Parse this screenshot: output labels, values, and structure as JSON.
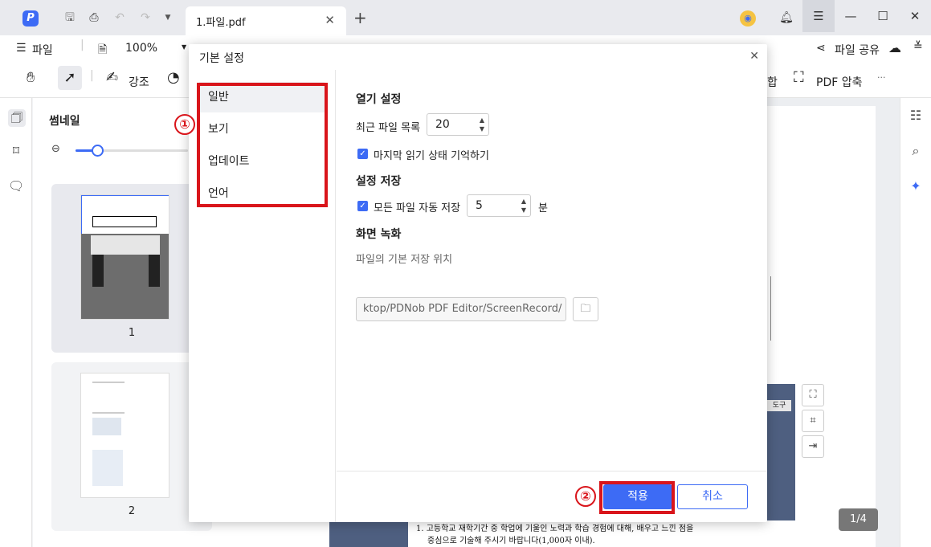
{
  "app": {
    "logo_letter": "P",
    "tab_title": "1.파일.pdf",
    "tab_add": "+"
  },
  "toolbar": {
    "file_menu": "파일",
    "zoom": "100%",
    "highlight": "강조",
    "merge_suffix": "합",
    "compress": "PDF 압축",
    "more": "···",
    "share": "파일 공유"
  },
  "thumbnails": {
    "title": "썸네일",
    "zoom_level": 0.2,
    "pages": [
      "1",
      "2"
    ]
  },
  "document": {
    "text_line1": "1. 고등학교 재학기간 중 학업에 기울인 노력과 학습 경험에 대해, 배우고 느낀 점을",
    "text_line2": "중심으로 기술해 주시기 바랍니다(1,000자 이내).",
    "window_tab": "도구"
  },
  "page_indicator": "1/4",
  "dialog": {
    "title": "기본 설정",
    "nav": [
      "일반",
      "보기",
      "업데이트",
      "언어"
    ],
    "open_settings": {
      "heading": "열기 설정",
      "recent_label": "최근 파일 목록",
      "recent_value": "20",
      "remember_label": "마지막 읽기 상태 기억하기",
      "remember_checked": true
    },
    "save_settings": {
      "heading": "설정 저장",
      "autosave_label": "모든 파일 자동 저장",
      "autosave_value": "5",
      "autosave_unit": "분",
      "autosave_checked": true
    },
    "screen_record": {
      "heading": "화면 녹화",
      "location_label": "파일의 기본 저장 위치",
      "location_value": "ktop/PDNob PDF Editor/ScreenRecord/"
    },
    "apply": "적용",
    "cancel": "취소"
  },
  "annotations": {
    "marker1": "①",
    "marker2": "②",
    "color": "#d9151b"
  },
  "colors": {
    "accent": "#3d6bf5"
  }
}
